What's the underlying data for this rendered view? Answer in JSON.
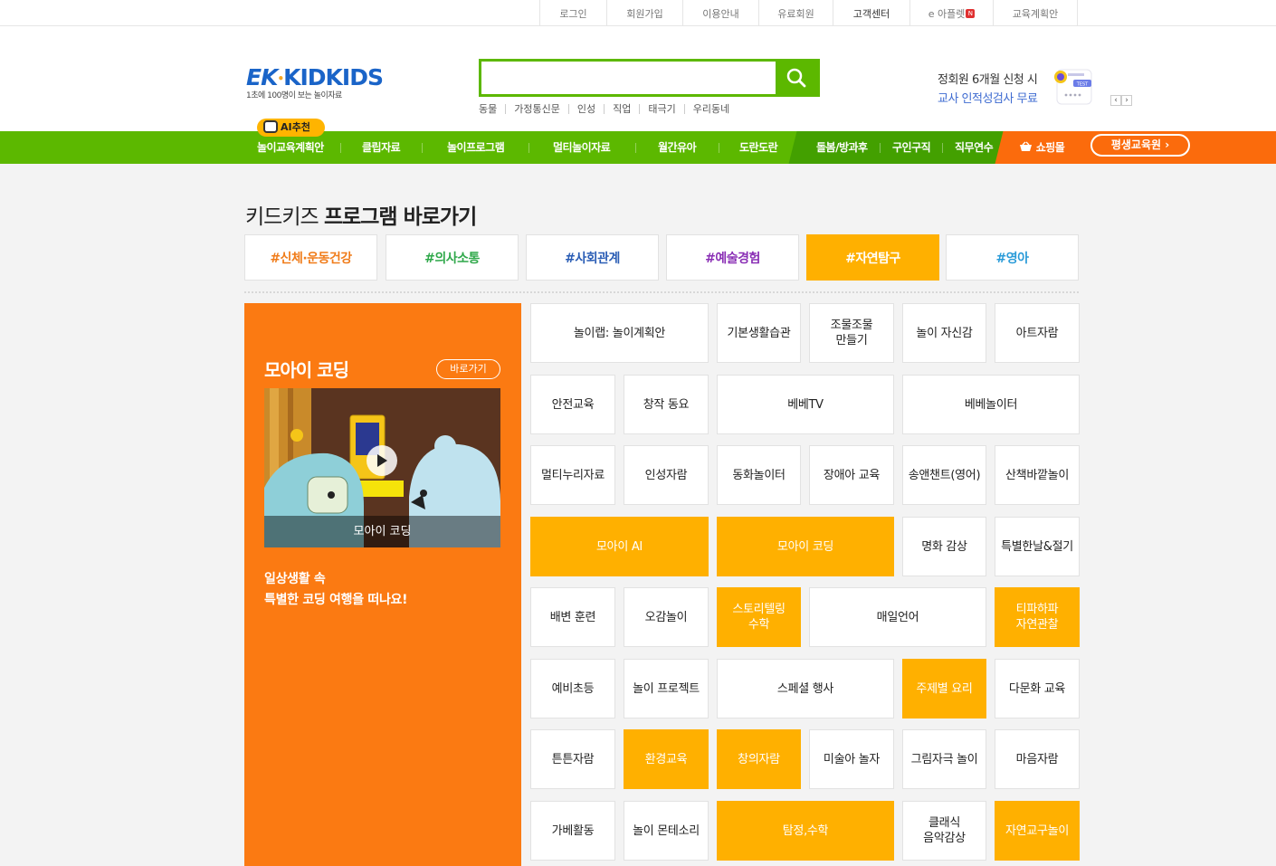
{
  "topbar": {
    "items": [
      "로그인",
      "회원가입",
      "이용안내",
      "유료회원",
      "고객센터",
      "e 아플렛",
      "교육계획안"
    ],
    "new_badge": "N"
  },
  "header": {
    "logo_ek": "EK",
    "logo_kidkids": "KIDKIDS",
    "logo_tagline": "1초에 100명이 보는 놀이자료",
    "search": {
      "value": "",
      "placeholder": ""
    },
    "keywords": [
      "동물",
      "가정통신문",
      "인성",
      "직업",
      "태극기",
      "우리동네"
    ],
    "promo_line1": "정회원 6개월 신청 시",
    "promo_line2": "교사 인적성검사 무료",
    "promo_badge": "TEST",
    "pager_prev": "‹",
    "pager_next": "›"
  },
  "nav": {
    "ai_badge": "AI추천",
    "items": [
      "놀이교육계획안",
      "클립자료",
      "놀이프로그램",
      "멀티놀이자료",
      "월간유아",
      "도란도란",
      "돌봄/방과후",
      "구인구직",
      "직무연수",
      "쇼핑몰"
    ],
    "lifelong": "평생교육원 ›"
  },
  "section": {
    "title_plain": "키드키즈 ",
    "title_bold": "프로그램 바로가기",
    "categories": [
      {
        "label": "#신체·운동건강",
        "color": "#f07c1a"
      },
      {
        "label": "#의사소통",
        "color": "#2fa84a"
      },
      {
        "label": "#사회관계",
        "color": "#2a5db5"
      },
      {
        "label": "#예술경험",
        "color": "#8a2fb5"
      },
      {
        "label": "#자연탐구",
        "color": "#ffffff"
      },
      {
        "label": "#영아",
        "color": "#2a9bd8"
      }
    ]
  },
  "feature": {
    "title": "모아이 코딩",
    "go_button": "바로가기",
    "video_caption": "모아이 코딩",
    "desc_line1": "일상생활 속",
    "desc_line2": "특별한 코딩 여행을 떠나요!"
  },
  "programs": [
    "놀이랩: 놀이계획안",
    "기본생활습관",
    "조물조물\n만들기",
    "놀이 자신감",
    "아트자람",
    "안전교육",
    "창작 동요",
    "베베TV",
    "베베놀이터",
    "멀티누리자료",
    "인성자람",
    "동화놀이터",
    "장애아 교육",
    "송앤챈트(영어)",
    "산책바깥놀이",
    "모아이 AI",
    "모아이 코딩",
    "명화 감상",
    "특별한날&절기",
    "배변 훈련",
    "오감놀이",
    "스토리텔링\n수학",
    "매일언어",
    "티파하파\n자연관찰",
    "예비초등",
    "놀이 프로젝트",
    "스페셜 행사",
    "주제별 요리",
    "다문화 교육",
    "튼튼자람",
    "환경교육",
    "창의자람",
    "미술아 놀자",
    "그림자극 놀이",
    "마음자람",
    "가베활동",
    "놀이 몬테소리",
    "탐정,수학",
    "클래식\n음악감상",
    "자연교구놀이"
  ],
  "colors": {
    "green": "#5cb800",
    "orange": "#fb7a12",
    "yellow": "#ffb000",
    "blue": "#1a64c8"
  }
}
